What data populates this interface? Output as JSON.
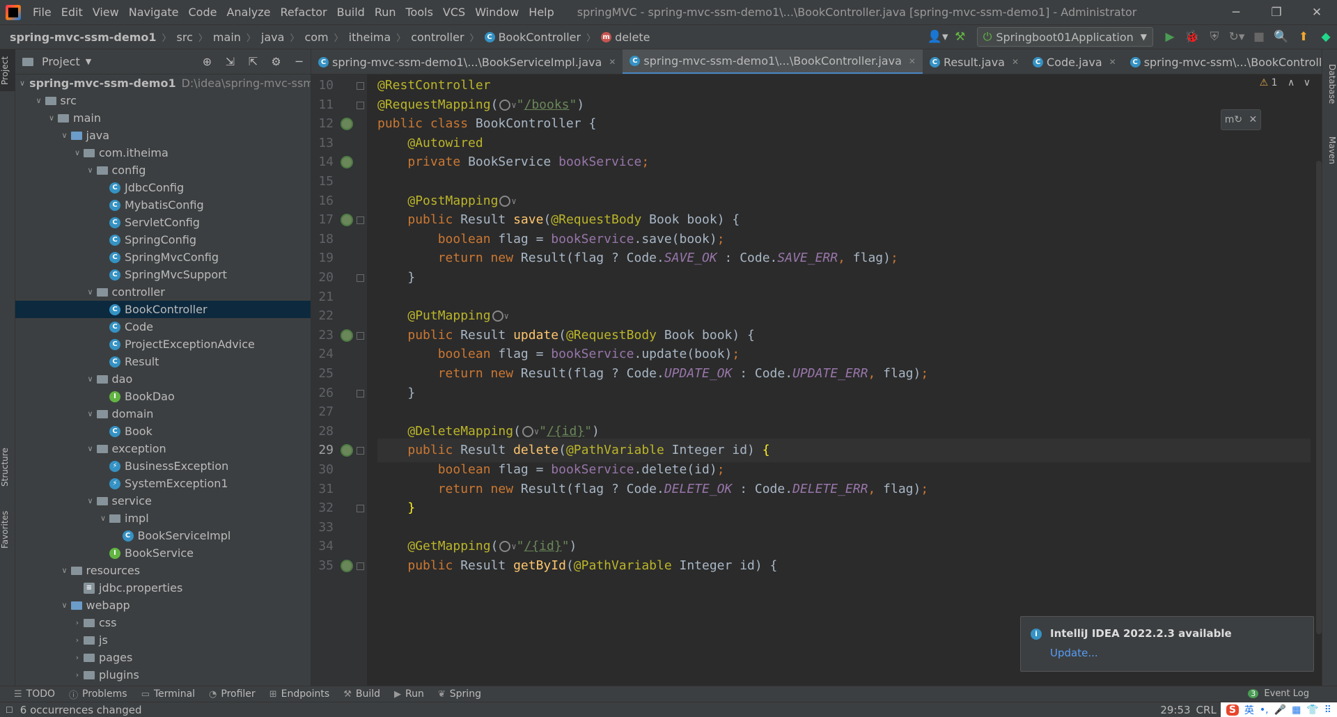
{
  "menu": [
    "File",
    "Edit",
    "View",
    "Navigate",
    "Code",
    "Analyze",
    "Refactor",
    "Build",
    "Run",
    "Tools",
    "VCS",
    "Window",
    "Help"
  ],
  "window_title": "springMVC - spring-mvc-ssm-demo1\\...\\BookController.java [spring-mvc-ssm-demo1] - Administrator",
  "breadcrumbs": [
    "spring-mvc-ssm-demo1",
    "src",
    "main",
    "java",
    "com",
    "itheima",
    "controller",
    "BookController",
    "delete"
  ],
  "run_config": "Springboot01Application",
  "project_panel": {
    "title": "Project",
    "root_path": "D:\\idea\\spring-mvc-ssm",
    "tree": [
      {
        "label": "spring-mvc-ssm-demo1",
        "depth": 0,
        "kind": "module",
        "open": true
      },
      {
        "label": "src",
        "depth": 1,
        "kind": "folder",
        "open": true
      },
      {
        "label": "main",
        "depth": 2,
        "kind": "folder",
        "open": true
      },
      {
        "label": "java",
        "depth": 3,
        "kind": "folder-blue",
        "open": true
      },
      {
        "label": "com.itheima",
        "depth": 4,
        "kind": "folder",
        "open": true
      },
      {
        "label": "config",
        "depth": 5,
        "kind": "folder",
        "open": true
      },
      {
        "label": "JdbcConfig",
        "depth": 6,
        "kind": "class"
      },
      {
        "label": "MybatisConfig",
        "depth": 6,
        "kind": "class"
      },
      {
        "label": "ServletConfig",
        "depth": 6,
        "kind": "class"
      },
      {
        "label": "SpringConfig",
        "depth": 6,
        "kind": "class"
      },
      {
        "label": "SpringMvcConfig",
        "depth": 6,
        "kind": "class"
      },
      {
        "label": "SpringMvcSupport",
        "depth": 6,
        "kind": "class"
      },
      {
        "label": "controller",
        "depth": 5,
        "kind": "folder",
        "open": true
      },
      {
        "label": "BookController",
        "depth": 6,
        "kind": "class",
        "selected": true
      },
      {
        "label": "Code",
        "depth": 6,
        "kind": "class"
      },
      {
        "label": "ProjectExceptionAdvice",
        "depth": 6,
        "kind": "class"
      },
      {
        "label": "Result",
        "depth": 6,
        "kind": "class"
      },
      {
        "label": "dao",
        "depth": 5,
        "kind": "folder",
        "open": true
      },
      {
        "label": "BookDao",
        "depth": 6,
        "kind": "interface"
      },
      {
        "label": "domain",
        "depth": 5,
        "kind": "folder",
        "open": true
      },
      {
        "label": "Book",
        "depth": 6,
        "kind": "class"
      },
      {
        "label": "exception",
        "depth": 5,
        "kind": "folder",
        "open": true
      },
      {
        "label": "BusinessException",
        "depth": 6,
        "kind": "exception"
      },
      {
        "label": "SystemException1",
        "depth": 6,
        "kind": "exception"
      },
      {
        "label": "service",
        "depth": 5,
        "kind": "folder",
        "open": true
      },
      {
        "label": "impl",
        "depth": 6,
        "kind": "folder",
        "open": true
      },
      {
        "label": "BookServiceImpl",
        "depth": 7,
        "kind": "class"
      },
      {
        "label": "BookService",
        "depth": 6,
        "kind": "interface"
      },
      {
        "label": "resources",
        "depth": 3,
        "kind": "folder",
        "open": true
      },
      {
        "label": "jdbc.properties",
        "depth": 4,
        "kind": "properties"
      },
      {
        "label": "webapp",
        "depth": 3,
        "kind": "folder-blue",
        "open": true
      },
      {
        "label": "css",
        "depth": 4,
        "kind": "folder",
        "open": false
      },
      {
        "label": "js",
        "depth": 4,
        "kind": "folder",
        "open": false
      },
      {
        "label": "pages",
        "depth": 4,
        "kind": "folder",
        "open": false
      },
      {
        "label": "plugins",
        "depth": 4,
        "kind": "folder",
        "open": false
      }
    ]
  },
  "tabs": [
    {
      "label": "spring-mvc-ssm-demo1\\...\\BookServiceImpl.java",
      "active": false
    },
    {
      "label": "spring-mvc-ssm-demo1\\...\\BookController.java",
      "active": true
    },
    {
      "label": "Result.java",
      "active": false
    },
    {
      "label": "Code.java",
      "active": false
    },
    {
      "label": "spring-mvc-ssm\\...\\BookController.java",
      "active": false
    }
  ],
  "warnings": "1",
  "code_lines": [
    {
      "n": "10",
      "bean": false,
      "fold": true,
      "html": "<span class='an'>@RestController</span>"
    },
    {
      "n": "11",
      "bean": false,
      "fold": true,
      "html": "<span class='an'>@RequestMapping</span>(<span class='web-ico'></span><span class='web-arrow'>∨</span><span class='str'>\"</span><span class='url'>/books</span><span class='str'>\"</span>)"
    },
    {
      "n": "12",
      "bean": true,
      "fold": false,
      "html": "<span class='kw'>public class </span>BookController {"
    },
    {
      "n": "13",
      "bean": false,
      "fold": false,
      "html": "    <span class='an'>@Autowired</span>"
    },
    {
      "n": "14",
      "bean": true,
      "fold": false,
      "html": "    <span class='kw'>private </span>BookService <span class='fld'>bookService</span><span class='kw'>;</span>"
    },
    {
      "n": "15",
      "bean": false,
      "fold": false,
      "html": ""
    },
    {
      "n": "16",
      "bean": false,
      "fold": false,
      "html": "    <span class='an'>@PostMapping</span><span class='web-ico'></span><span class='web-arrow'>∨</span>"
    },
    {
      "n": "17",
      "bean": true,
      "fold": true,
      "html": "    <span class='kw'>public </span>Result <span class='fn'>save</span>(<span class='an'>@RequestBody </span>Book book) {"
    },
    {
      "n": "18",
      "bean": false,
      "fold": false,
      "html": "        <span class='kw'>boolean </span>flag = <span class='fld'>bookService</span>.save(book)<span class='kw'>;</span>"
    },
    {
      "n": "19",
      "bean": false,
      "fold": false,
      "html": "        <span class='kw'>return new </span>Result(flag ? Code.<span class='sfld'>SAVE_OK</span> : Code.<span class='sfld'>SAVE_ERR</span><span class='kw'>, </span>flag)<span class='kw'>;</span>"
    },
    {
      "n": "20",
      "bean": false,
      "fold": true,
      "html": "    }"
    },
    {
      "n": "21",
      "bean": false,
      "fold": false,
      "html": ""
    },
    {
      "n": "22",
      "bean": false,
      "fold": false,
      "html": "    <span class='an'>@PutMapping</span><span class='web-ico'></span><span class='web-arrow'>∨</span>"
    },
    {
      "n": "23",
      "bean": true,
      "fold": true,
      "html": "    <span class='kw'>public </span>Result <span class='fn'>update</span>(<span class='an'>@RequestBody </span>Book book) {"
    },
    {
      "n": "24",
      "bean": false,
      "fold": false,
      "html": "        <span class='kw'>boolean </span>flag = <span class='fld'>bookService</span>.update(book)<span class='kw'>;</span>"
    },
    {
      "n": "25",
      "bean": false,
      "fold": false,
      "html": "        <span class='kw'>return new </span>Result(flag ? Code.<span class='sfld'>UPDATE_OK</span> : Code.<span class='sfld'>UPDATE_ERR</span><span class='kw'>, </span>flag)<span class='kw'>;</span>"
    },
    {
      "n": "26",
      "bean": false,
      "fold": true,
      "html": "    }"
    },
    {
      "n": "27",
      "bean": false,
      "fold": false,
      "html": ""
    },
    {
      "n": "28",
      "bean": false,
      "fold": false,
      "html": "    <span class='an'>@DeleteMapping</span>(<span class='web-ico'></span><span class='web-arrow'>∨</span><span class='str'>\"</span><span class='url'>/{id}</span><span class='str'>\"</span>)"
    },
    {
      "n": "29",
      "bean": true,
      "fold": true,
      "cur": true,
      "html": "    <span class='kw'>public </span>Result <span class='fn'>delete</span>(<span class='an'>@PathVariable </span>Integer id) <span class='brc'>{</span>"
    },
    {
      "n": "30",
      "bean": false,
      "fold": false,
      "html": "        <span class='kw'>boolean </span>flag = <span class='fld'>bookService</span>.delete(id)<span class='kw'>;</span>"
    },
    {
      "n": "31",
      "bean": false,
      "fold": false,
      "html": "        <span class='kw'>return new </span>Result(flag ? Code.<span class='sfld'>DELETE_OK</span> : Code.<span class='sfld'>DELETE_ERR</span><span class='kw'>, </span>flag)<span class='kw'>;</span>"
    },
    {
      "n": "32",
      "bean": false,
      "fold": true,
      "html": "    <span class='brc'>}</span>"
    },
    {
      "n": "33",
      "bean": false,
      "fold": false,
      "html": ""
    },
    {
      "n": "34",
      "bean": false,
      "fold": false,
      "html": "    <span class='an'>@GetMapping</span>(<span class='web-ico'></span><span class='web-arrow'>∨</span><span class='str'>\"</span><span class='url'>/{id}</span><span class='str'>\"</span>)"
    },
    {
      "n": "35",
      "bean": true,
      "fold": true,
      "html": "    <span class='kw'>public </span>Result <span class='fn'>getById</span>(<span class='an'>@PathVariable </span>Integer id) {"
    }
  ],
  "notification": {
    "title": "IntelliJ IDEA 2022.2.3 available",
    "link": "Update..."
  },
  "bottom_tabs": [
    "TODO",
    "Problems",
    "Terminal",
    "Profiler",
    "Endpoints",
    "Build",
    "Run",
    "Spring"
  ],
  "event_log": {
    "count": "3",
    "label": "Event Log"
  },
  "status": {
    "message": "6 occurrences changed",
    "position": "29:53",
    "line_sep": "CRL"
  },
  "ime": [
    "S",
    "英",
    "•,",
    "🎤",
    "▦",
    "👕",
    "⠿"
  ],
  "left_strip": [
    "Project",
    "Structure",
    "Favorites"
  ],
  "right_strip": [
    "Database",
    "Maven"
  ]
}
